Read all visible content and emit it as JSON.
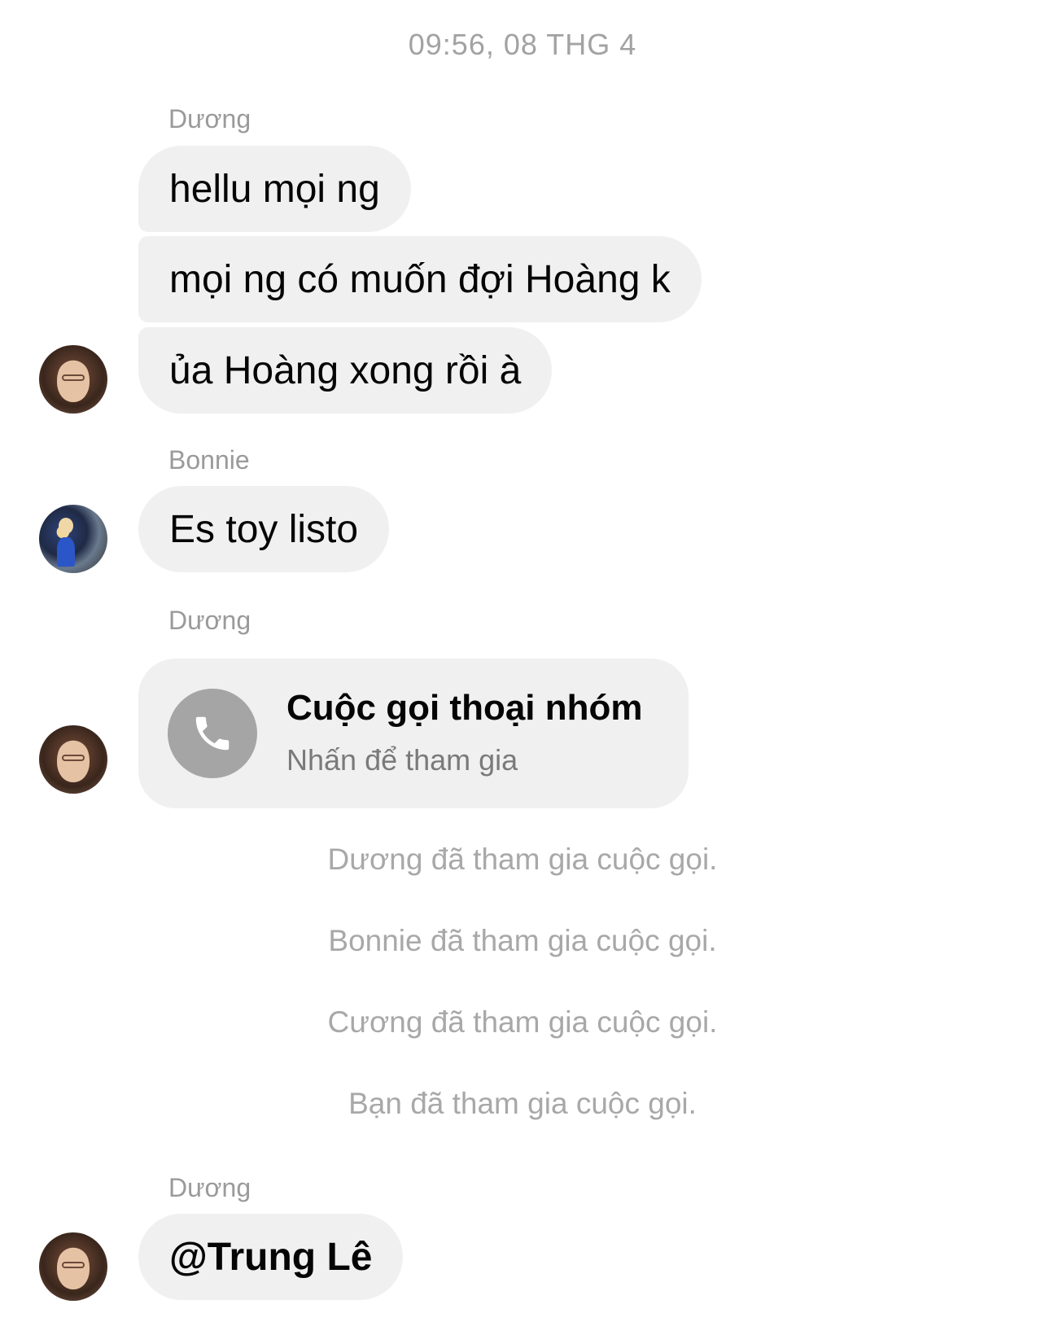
{
  "header": {
    "timestamp": "09:56, 08 THG 4"
  },
  "messages": [
    {
      "sender": "Dương",
      "bubbles": [
        "hellu mọi ng",
        "mọi ng có muốn đợi Hoàng k",
        "ủa Hoàng xong rồi à"
      ]
    },
    {
      "sender": "Bonnie",
      "bubbles": [
        "Es toy listo"
      ]
    },
    {
      "sender": "Dương",
      "call": {
        "icon": "phone-icon",
        "title": "Cuộc gọi thoại nhóm",
        "subtitle": "Nhấn để tham gia"
      }
    },
    {
      "sender": "Dương",
      "bubbles": [
        "@Trung Lê"
      ]
    }
  ],
  "system_events": [
    "Dương đã tham gia cuộc gọi.",
    "Bonnie đã tham gia cuộc gọi.",
    "Cương đã tham gia cuộc gọi.",
    "Bạn đã tham gia cuộc gọi."
  ],
  "colors": {
    "bubble": "#f0f0f0",
    "meta_text": "#a2a2a2",
    "call_icon_bg": "#a5a5a5"
  }
}
